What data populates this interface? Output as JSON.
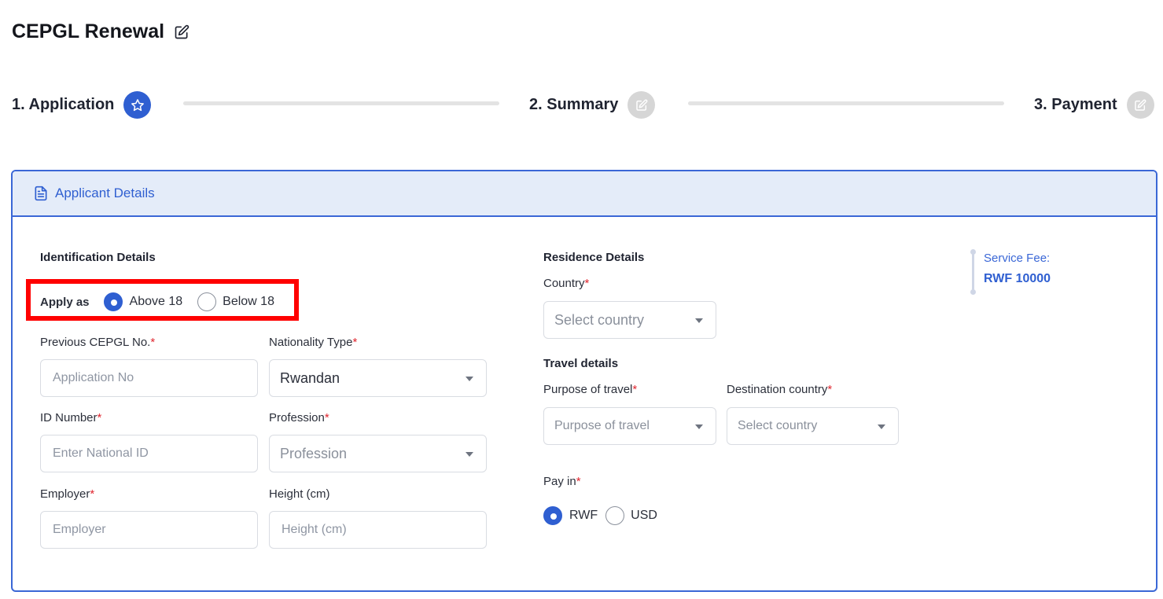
{
  "page": {
    "title": "CEPGL Renewal"
  },
  "steps": [
    {
      "label": "1. Application",
      "state": "active",
      "icon": "star-icon"
    },
    {
      "label": "2. Summary",
      "state": "inactive",
      "icon": "edit-icon"
    },
    {
      "label": "3. Payment",
      "state": "inactive",
      "icon": "edit-icon"
    }
  ],
  "card": {
    "header": "Applicant Details",
    "icon": "document-icon"
  },
  "identification": {
    "title": "Identification Details",
    "apply_as_label": "Apply as",
    "apply_options": [
      {
        "label": "Above 18",
        "checked": true
      },
      {
        "label": "Below 18",
        "checked": false
      }
    ],
    "previous_no": {
      "label": "Previous CEPGL No.",
      "required": "*",
      "placeholder": "Application No"
    },
    "nationality": {
      "label": "Nationality Type",
      "required": "*",
      "value": "Rwandan"
    },
    "id_number": {
      "label": "ID Number",
      "required": "*",
      "placeholder": "Enter National ID"
    },
    "profession": {
      "label": "Profession",
      "required": "*",
      "placeholder": "Profession"
    },
    "employer": {
      "label": "Employer",
      "required": "*",
      "placeholder": "Employer"
    },
    "height": {
      "label": "Height (cm)",
      "placeholder": "Height (cm)"
    }
  },
  "residence": {
    "title": "Residence Details",
    "country": {
      "label": "Country",
      "required": "*",
      "placeholder": "Select country"
    }
  },
  "travel": {
    "title": "Travel details",
    "purpose": {
      "label": "Purpose of travel",
      "required": "*",
      "placeholder": "Purpose of travel"
    },
    "destination": {
      "label": "Destination country",
      "required": "*",
      "placeholder": "Select country"
    }
  },
  "payment": {
    "label": "Pay in",
    "required": "*",
    "options": [
      {
        "label": "RWF",
        "checked": true
      },
      {
        "label": "USD",
        "checked": false
      }
    ]
  },
  "fee": {
    "label": "Service Fee:",
    "value": "RWF 10000"
  },
  "colors": {
    "accent": "#2f5fd1",
    "highlight": "#ff0000",
    "required": "#e0262f",
    "header_bg": "#e4ecf9"
  }
}
